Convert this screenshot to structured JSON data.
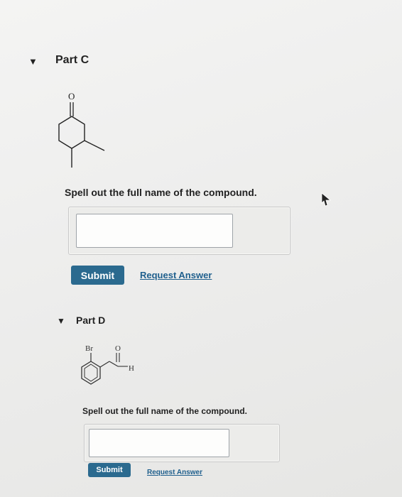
{
  "part_c": {
    "toggle_icon": "triangle-down",
    "title": "Part C",
    "structure_labels": {
      "oxygen": "O"
    },
    "prompt": "Spell out the full name of the compound.",
    "answer_value": "",
    "submit_label": "Submit",
    "request_answer_label": "Request Answer"
  },
  "part_d": {
    "toggle_icon": "triangle-down",
    "title": "Part D",
    "structure_labels": {
      "bromine": "Br",
      "oxygen": "O",
      "hydrogen": "H"
    },
    "prompt": "Spell out the full name of the compound.",
    "answer_value": "",
    "submit_label": "Submit",
    "request_answer_label": "Request Answer"
  },
  "colors": {
    "submit_bg": "#2b6a8f",
    "link": "#1f5f8d"
  },
  "icons": [
    "chevron-down-icon",
    "mouse-cursor-icon"
  ]
}
